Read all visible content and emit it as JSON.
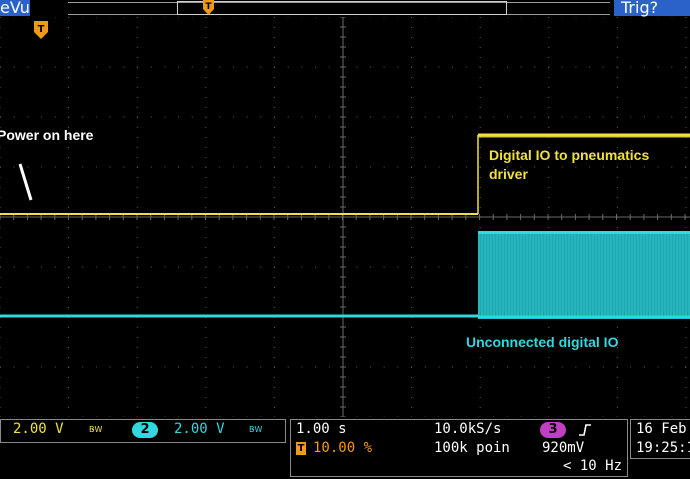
{
  "colors": {
    "ch1": "#f0e040",
    "ch2": "#30d8e0",
    "ch3": "#c040c0",
    "trigger": "#f09a1a",
    "grid": "#5a5a5a",
    "topbar_accent": "#2a62c9",
    "annotation_white": "#ffffff"
  },
  "topbar": {
    "left_label": "eVu",
    "right_label": "Trig?",
    "trigger_marker_glyph": "T"
  },
  "trigger_marker_plot": "T",
  "annotations": {
    "power_on": "Power on here",
    "digital_io_line1": "Digital IO to pneumatics",
    "digital_io_line2": "driver",
    "unconnected": "Unconnected digital IO"
  },
  "bottombar": {
    "ch1_scale": "2.00 V",
    "ch1_bw": "B̵W",
    "ch2_badge": "2",
    "ch2_scale": "2.00 V",
    "ch2_bw": "B̵W",
    "timebase": "1.00 s",
    "trigger_pos_glyph": "T",
    "trigger_pos": "10.00 %",
    "sample_rate": "10.0kS/s",
    "record_length": "100k poin",
    "trig_source_badge": "3",
    "trig_slope_glyph": "ℱ",
    "trig_level": "920mV",
    "trig_freq": "< 10 Hz",
    "date": "16 Feb",
    "time": "19:25:1"
  }
}
